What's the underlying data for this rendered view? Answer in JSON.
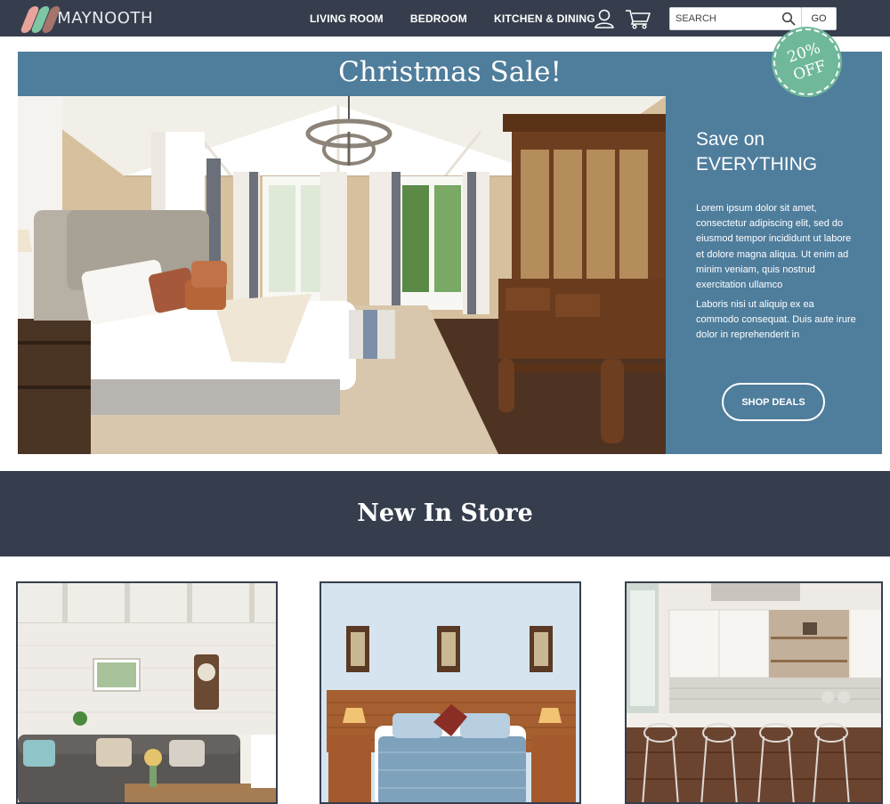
{
  "brand": {
    "name": "MAYNOOTH",
    "logo_colors": [
      "#e8a39a",
      "#7fc6a4",
      "#a5746c"
    ]
  },
  "nav": {
    "links": [
      "LIVING ROOM",
      "BEDROOM",
      "KITCHEN & DINING"
    ],
    "user_icon": "user-icon",
    "cart_icon": "cart-icon",
    "search": {
      "placeholder": "SEARCH",
      "icon": "search-icon",
      "button_label": "GO"
    }
  },
  "hero": {
    "title": "Christmas Sale!",
    "badge": "20% OFF",
    "heading_line1": "Save on",
    "heading_line2": "EVERYTHING",
    "paragraph1": "Lorem ipsum dolor sit amet, consectetur adipiscing elit, sed do eiusmod tempor incididunt ut labore et dolore magna aliqua. Ut enim ad minim veniam, quis nostrud exercitation ullamco",
    "paragraph2": "Laboris nisi ut aliquip ex ea commodo consequat. Duis aute irure dolor in reprehenderit in",
    "cta_label": "SHOP DEALS",
    "image": "bedroom-photo"
  },
  "new_in_store": {
    "title": "New In Store",
    "products": [
      {
        "image": "living-room-photo"
      },
      {
        "image": "bedroom-photo"
      },
      {
        "image": "kitchen-photo"
      }
    ]
  },
  "colors": {
    "nav_bg": "#363e4d",
    "hero_bg": "#4f7d9c",
    "badge_bg": "#6fb89a",
    "text_light": "#ffffff"
  }
}
